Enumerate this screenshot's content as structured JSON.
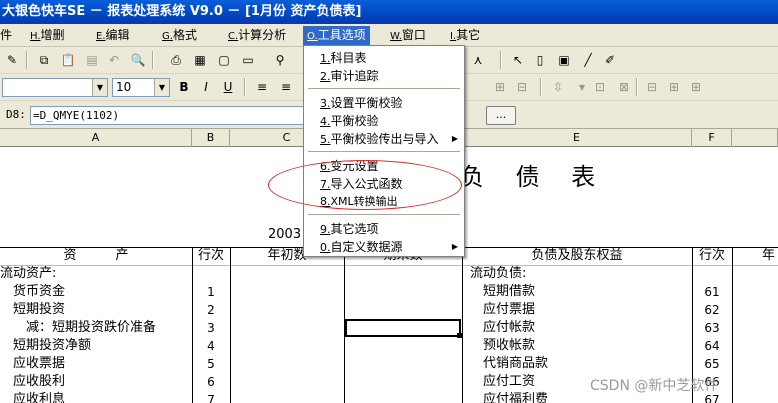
{
  "window": {
    "title": "大银色快车SE － 报表处理系统 V9.0 － [1月份 资产负债表]"
  },
  "menubar": {
    "items": [
      {
        "key": "",
        "label": "件"
      },
      {
        "key": "H.",
        "label": "增删"
      },
      {
        "key": "E.",
        "label": "编辑"
      },
      {
        "key": "G.",
        "label": "格式"
      },
      {
        "key": "C.",
        "label": "计算分析"
      },
      {
        "key": "O.",
        "label": "工具选项"
      },
      {
        "key": "W.",
        "label": "窗口"
      },
      {
        "key": "I.",
        "label": "其它"
      }
    ]
  },
  "toolbar": {
    "font_size": "10"
  },
  "formula_bar": {
    "cell_ref": "D8:",
    "formula": "=D_QMYE(1102)",
    "button_label": "..."
  },
  "columns": [
    "A",
    "B",
    "C",
    "E",
    "F"
  ],
  "tools_menu": {
    "items": [
      {
        "key": "1.",
        "label": "科目表"
      },
      {
        "key": "2.",
        "label": "审计追踪"
      },
      {
        "key": "3.",
        "label": "设置平衡校验"
      },
      {
        "key": "4.",
        "label": "平衡校验"
      },
      {
        "key": "5.",
        "label": "平衡校验传出与导入"
      },
      {
        "key": "6.",
        "label": "变元设置"
      },
      {
        "key": "7.",
        "label": "导入公式函数"
      },
      {
        "key": "8.",
        "label": "XML转换输出"
      },
      {
        "key": "9.",
        "label": "其它选项"
      },
      {
        "key": "0.",
        "label": "自定义数据源"
      }
    ]
  },
  "sheet": {
    "title": "负 债 表",
    "year_fragment": "2003",
    "header": {
      "assets": "资　　　产",
      "line_no": "行次",
      "begin": "年初数",
      "end": "期末数",
      "liabilities": "负债及股东权益",
      "line_no2": "行次",
      "year_col": "年"
    },
    "left_rows": [
      {
        "label": "流动资产:",
        "no": ""
      },
      {
        "label": "　货币资金",
        "no": "1"
      },
      {
        "label": "　短期投资",
        "no": "2"
      },
      {
        "label": "　　减：短期投资跌价准备",
        "no": "3"
      },
      {
        "label": "　短期投资净额",
        "no": "4"
      },
      {
        "label": "　应收票据",
        "no": "5"
      },
      {
        "label": "　应收股利",
        "no": "6"
      },
      {
        "label": "　应收利息",
        "no": "7"
      }
    ],
    "right_rows": [
      {
        "label": "流动负债:",
        "no": ""
      },
      {
        "label": "　短期借款",
        "no": "61"
      },
      {
        "label": "　应付票据",
        "no": "62"
      },
      {
        "label": "　应付帐款",
        "no": "63"
      },
      {
        "label": "　预收帐款",
        "no": "64"
      },
      {
        "label": "　代销商品款",
        "no": "65"
      },
      {
        "label": "　应付工资",
        "no": "66"
      },
      {
        "label": "　应付福利费",
        "no": "67"
      }
    ]
  },
  "watermark": "CSDN @新中芝软件"
}
